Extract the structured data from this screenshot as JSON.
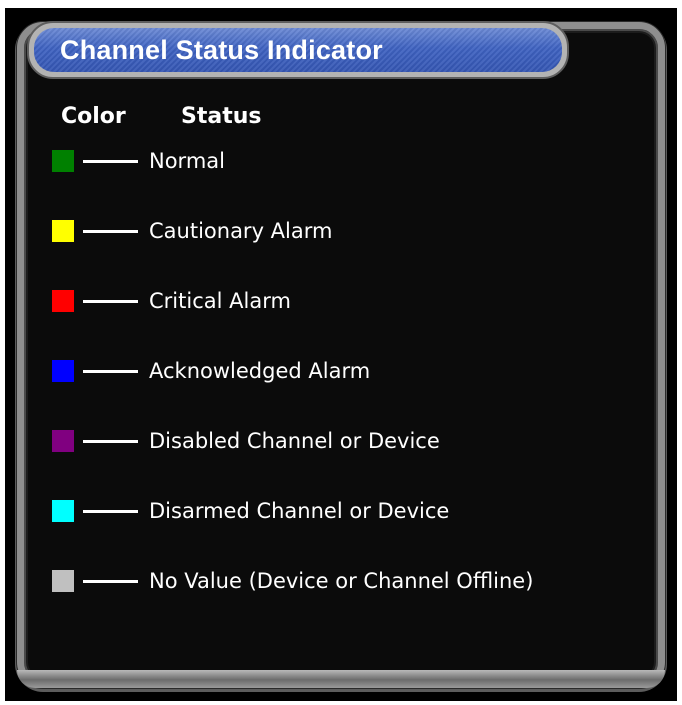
{
  "panel": {
    "title": "Channel Status Indicator"
  },
  "headers": {
    "color": "Color",
    "status": "Status"
  },
  "legend": [
    {
      "color": "#008000",
      "label": "Normal"
    },
    {
      "color": "#ffff00",
      "label": "Cautionary Alarm"
    },
    {
      "color": "#ff0000",
      "label": "Critical Alarm"
    },
    {
      "color": "#0000ff",
      "label": "Acknowledged Alarm"
    },
    {
      "color": "#800080",
      "label": "Disabled Channel or Device"
    },
    {
      "color": "#00ffff",
      "label": "Disarmed Channel or Device"
    },
    {
      "color": "#c0c0c0",
      "label": "No Value (Device or Channel Offline)"
    }
  ]
}
